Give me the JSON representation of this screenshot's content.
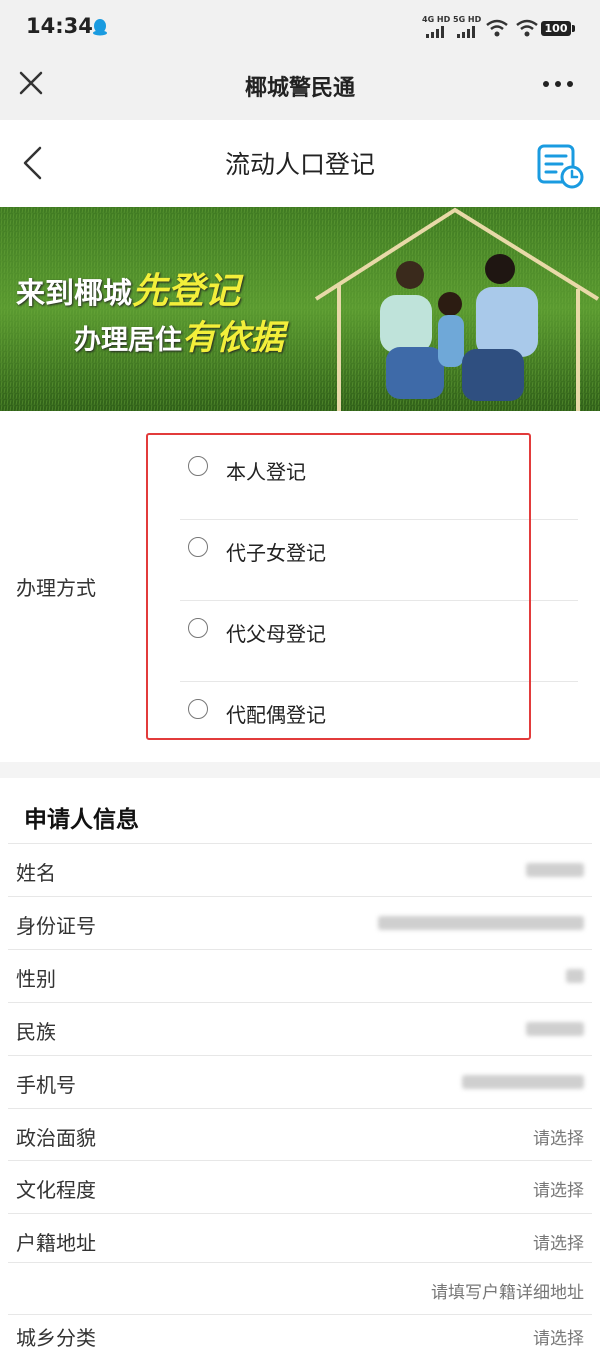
{
  "status": {
    "time": "14:34",
    "net1": "4G HD",
    "net2": "5G HD",
    "battery": "100"
  },
  "app": {
    "title": "椰城警民通"
  },
  "page": {
    "title": "流动人口登记"
  },
  "banner": {
    "line1_prefix": "来到椰城",
    "line1_highlight": "先登记",
    "line2_prefix": "办理居住",
    "line2_highlight": "有依据"
  },
  "method": {
    "label": "办理方式",
    "options": [
      "本人登记",
      "代子女登记",
      "代父母登记",
      "代配偶登记"
    ]
  },
  "applicant": {
    "title": "申请人信息",
    "fields": [
      {
        "label": "姓名",
        "value": "",
        "masked": true
      },
      {
        "label": "身份证号",
        "value": "",
        "masked": true
      },
      {
        "label": "性别",
        "value": "",
        "masked": true
      },
      {
        "label": "民族",
        "value": "",
        "masked": true
      },
      {
        "label": "手机号",
        "value": "",
        "masked": true
      },
      {
        "label": "政治面貌",
        "value": "请选择"
      },
      {
        "label": "文化程度",
        "value": "请选择"
      },
      {
        "label": "户籍地址",
        "value": "请选择"
      },
      {
        "label": "",
        "value": "请填写户籍详细地址"
      }
    ],
    "partial_label": "城乡分类",
    "partial_value": "请选择"
  },
  "colors": {
    "highlight_border": "#e23b3b",
    "accent_blue": "#1a9be0",
    "grass": "#4e8b2a"
  }
}
